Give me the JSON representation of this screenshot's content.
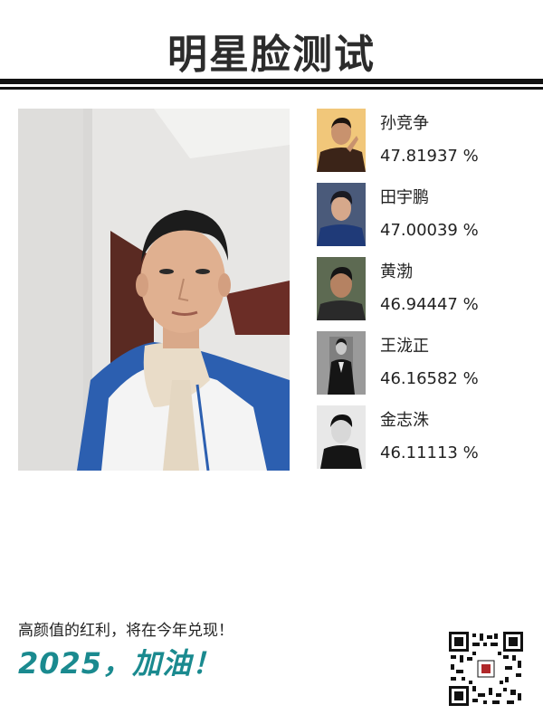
{
  "header": {
    "title": "明星脸测试"
  },
  "matches": [
    {
      "name": "孙竞争",
      "score": "47.81937 %"
    },
    {
      "name": "田宇鹏",
      "score": "47.00039 %"
    },
    {
      "name": "黄渤",
      "score": "46.94447 %"
    },
    {
      "name": "王泷正",
      "score": "46.16582 %"
    },
    {
      "name": "金志洙",
      "score": "46.11113 %"
    }
  ],
  "footer": {
    "slogan": "高颜值的红利，将在今年兑现！",
    "cheer": "2025，加油！"
  },
  "colors": {
    "accent": "#1a8a8f",
    "rule": "#111111",
    "title": "#2c2c2c"
  }
}
